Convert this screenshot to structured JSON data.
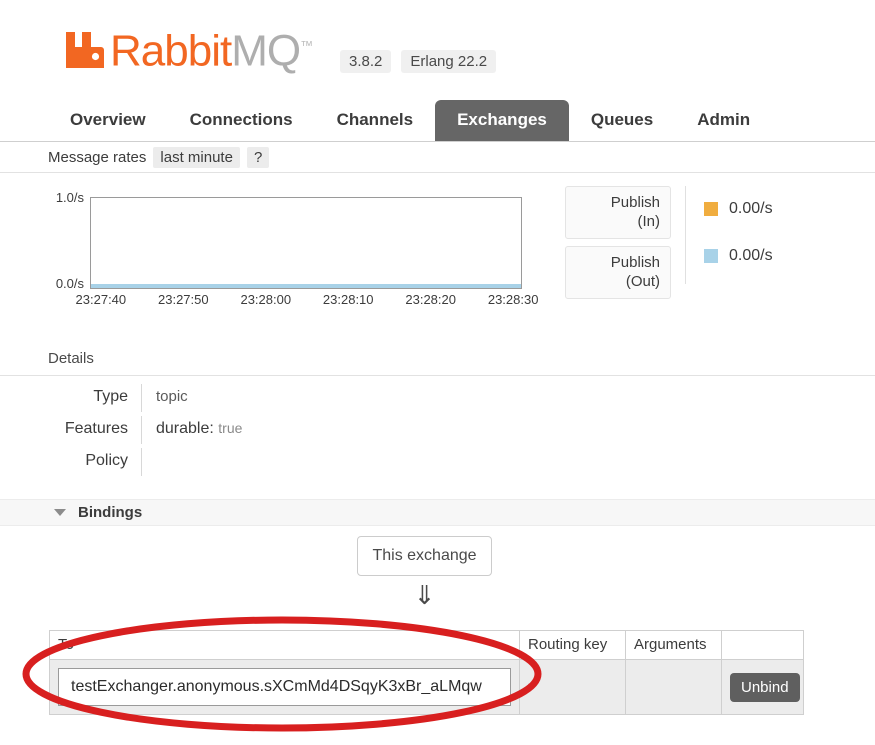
{
  "header": {
    "logo_icon": "rabbitmq-logo-icon",
    "brand_first": "Rabbit",
    "brand_second": "MQ",
    "brand_tm": "™",
    "version_badges": [
      "3.8.2",
      "Erlang 22.2"
    ],
    "brand_orange": "#f26722",
    "brand_gray": "#aeaeae"
  },
  "nav": {
    "tabs": [
      {
        "label": "Overview",
        "active": false
      },
      {
        "label": "Connections",
        "active": false
      },
      {
        "label": "Channels",
        "active": false
      },
      {
        "label": "Exchanges",
        "active": true
      },
      {
        "label": "Queues",
        "active": false
      },
      {
        "label": "Admin",
        "active": false
      }
    ],
    "active_tab_bg": "#666666"
  },
  "message_rates": {
    "label": "Message rates",
    "period_chip": "last minute",
    "help_chip": "?"
  },
  "chart_data": {
    "type": "line",
    "title": "Message rates",
    "xlabel": "",
    "ylabel": "",
    "ylim": [
      0.0,
      1.0
    ],
    "y_ticks": [
      "0.0/s",
      "1.0/s"
    ],
    "grid": false,
    "legend_position": "right",
    "x": [
      "23:27:40",
      "23:27:50",
      "23:28:00",
      "23:28:10",
      "23:28:20",
      "23:28:30"
    ],
    "series": [
      {
        "name": "Publish (In)",
        "label_line1": "Publish",
        "label_line2": "(In)",
        "color": "#f0ad3f",
        "current_value": "0.00/s",
        "values": [
          0.0,
          0.0,
          0.0,
          0.0,
          0.0,
          0.0
        ]
      },
      {
        "name": "Publish (Out)",
        "label_line1": "Publish",
        "label_line2": "(Out)",
        "color": "#a8d2e8",
        "current_value": "0.00/s",
        "values": [
          0.0,
          0.0,
          0.0,
          0.0,
          0.0,
          0.0
        ]
      }
    ]
  },
  "details": {
    "heading": "Details",
    "rows": [
      {
        "label": "Type",
        "value": "topic"
      },
      {
        "label": "Features",
        "feature_key": "durable:",
        "feature_value": "true"
      },
      {
        "label": "Policy",
        "value": ""
      }
    ]
  },
  "bindings": {
    "section_title": "Bindings",
    "caret_icon": "triangle-down-icon",
    "this_exchange_label": "This exchange",
    "down_arrow_icon": "double-arrow-down-icon",
    "arrow_glyph": "⇓",
    "columns": [
      "To",
      "Routing key",
      "Arguments",
      ""
    ],
    "rows": [
      {
        "to": "testExchanger.anonymous.sXCmMd4DSqyK3xBr_aLMqw",
        "routing_key": "*",
        "arguments": "",
        "action_label": "Unbind"
      }
    ]
  },
  "annotation": {
    "shape": "ellipse",
    "color": "#d81f1f"
  }
}
